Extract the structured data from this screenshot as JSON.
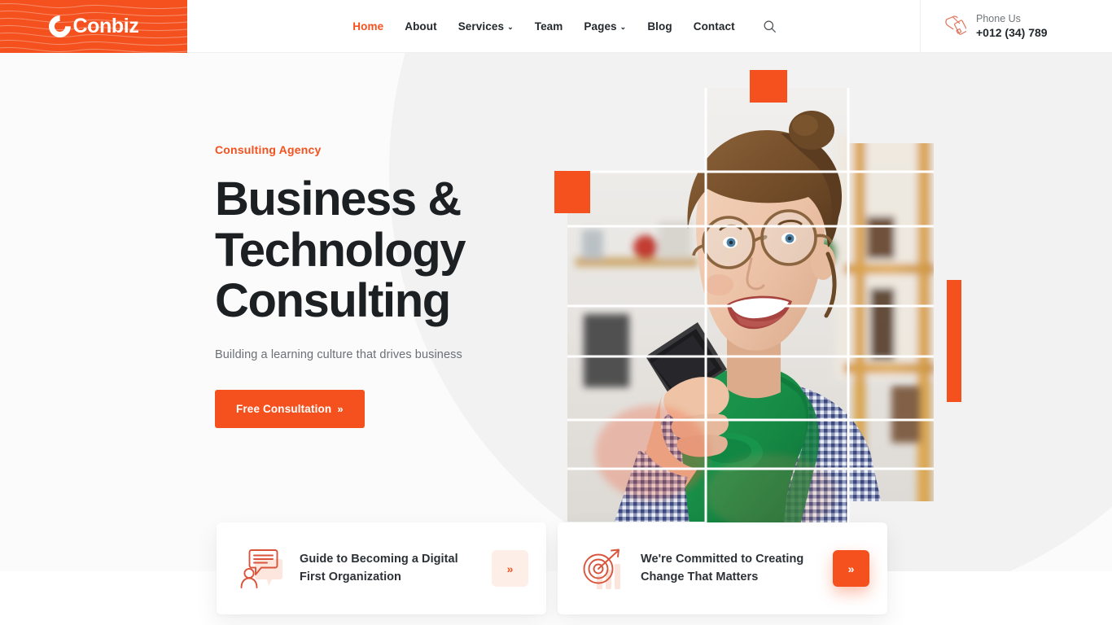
{
  "brand": {
    "name": "Conbiz",
    "logo_mark": "c-letter-logo",
    "accent_color": "#f4511e"
  },
  "header": {
    "nav": [
      {
        "label": "Home",
        "active": true,
        "has_dropdown": false
      },
      {
        "label": "About",
        "active": false,
        "has_dropdown": false
      },
      {
        "label": "Services",
        "active": false,
        "has_dropdown": true
      },
      {
        "label": "Team",
        "active": false,
        "has_dropdown": false
      },
      {
        "label": "Pages",
        "active": false,
        "has_dropdown": true
      },
      {
        "label": "Blog",
        "active": false,
        "has_dropdown": false
      },
      {
        "label": "Contact",
        "active": false,
        "has_dropdown": false
      }
    ],
    "caret_glyph": "⌄",
    "search_icon": "search-icon",
    "phone": {
      "icon": "hand-holding-phone-icon",
      "label": "Phone Us",
      "number": "+012 (34) 789"
    }
  },
  "hero": {
    "eyebrow": "Consulting Agency",
    "title": "Business & Technology Consulting",
    "title_line1": "Business &",
    "title_line2": "Technology",
    "title_line3": "Consulting",
    "subtitle": "Building a learning culture that drives business",
    "cta_label": "Free Consultation",
    "cta_chevron": "»",
    "image_alt": "Smiling woman with glasses talking on a mobile phone in an office"
  },
  "feature_cards": [
    {
      "icon": "chat-person-icon",
      "title": "Guide to Becoming a Digital First Organization",
      "button_glyph": "»",
      "button_style": "soft"
    },
    {
      "icon": "target-arrow-icon",
      "title": "We're Committed to Creating Change That Matters",
      "button_glyph": "»",
      "button_style": "solid"
    }
  ]
}
